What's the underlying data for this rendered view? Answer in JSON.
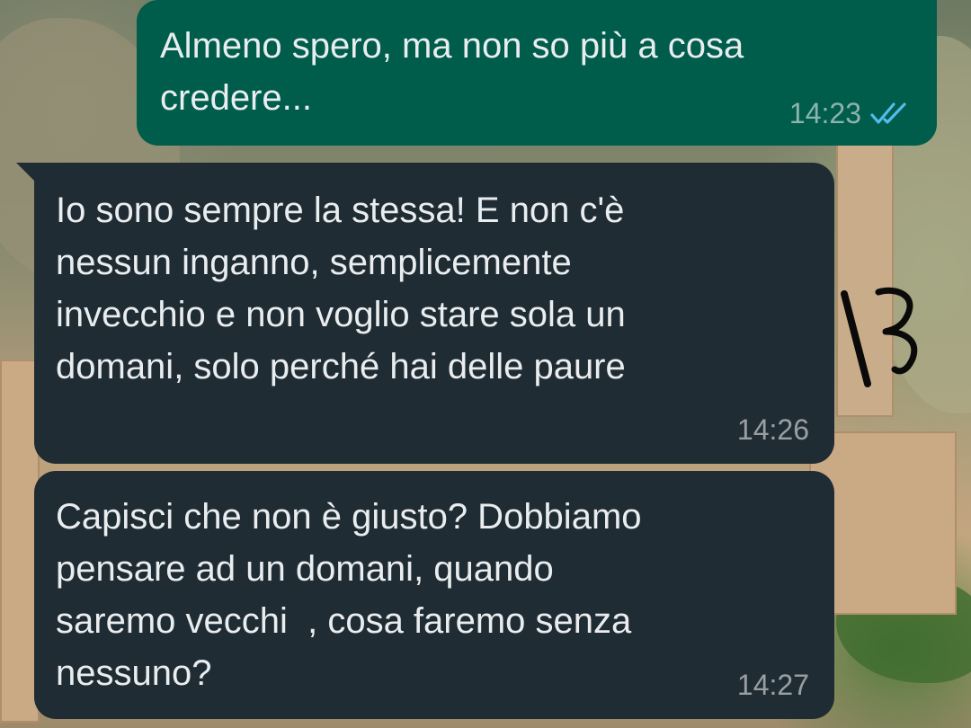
{
  "conversation": {
    "messages": [
      {
        "direction": "outgoing",
        "text": "Almeno spero, ma non so più a cosa\ncredere...",
        "time": "14:23",
        "status_icon": "double-check-read-icon"
      },
      {
        "direction": "incoming",
        "text": "Io sono sempre la stessa! E non c'è\nnessun inganno, semplicemente\ninvecchio e non voglio stare sola un\ndomani, solo perché hai delle paure",
        "time": "14:26"
      },
      {
        "direction": "incoming",
        "text": "Capisci che non è giusto? Dobbiamo\npensare ad un domani, quando\nsaremo vecchi  , cosa faremo senza\nnessuno?",
        "time": "14:27"
      }
    ]
  },
  "annotation": {
    "handwritten": "13"
  },
  "colors": {
    "outgoing_bubble": "#005c4b",
    "incoming_bubble": "#202c33",
    "text": "#e9edef",
    "read_tick": "#53bdeb"
  }
}
